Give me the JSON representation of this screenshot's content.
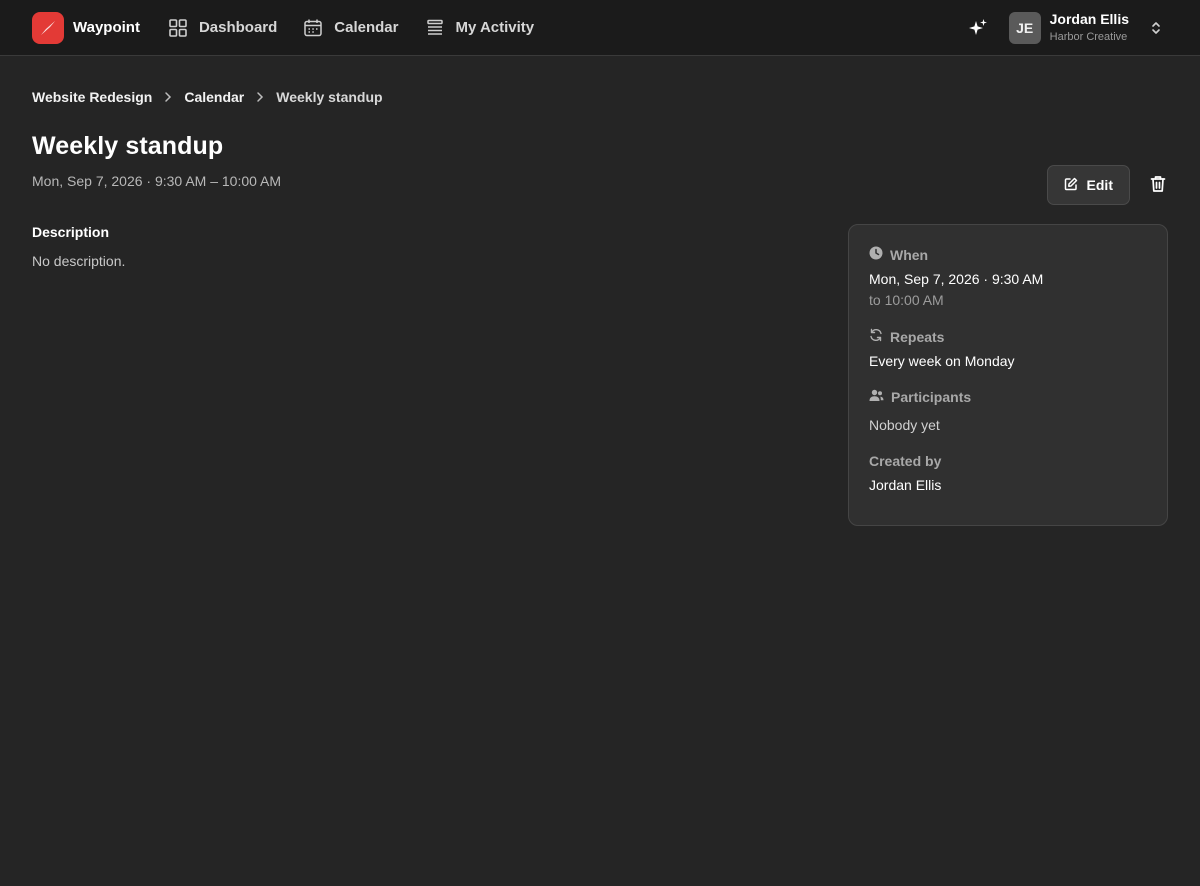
{
  "app": {
    "name": "Waypoint"
  },
  "nav": {
    "items": [
      {
        "label": "Dashboard",
        "icon": "grid-icon"
      },
      {
        "label": "Calendar",
        "icon": "calendar-icon"
      },
      {
        "label": "My Activity",
        "icon": "list-icon"
      }
    ]
  },
  "user": {
    "initials": "JE",
    "name": "Jordan Ellis",
    "org": "Harbor Creative"
  },
  "breadcrumb": {
    "items": [
      "Website Redesign",
      "Calendar",
      "Weekly standup"
    ]
  },
  "event": {
    "title": "Weekly standup",
    "subtitle": "Mon, Sep 7, 2026 · 9:30 AM – 10:00 AM"
  },
  "actions": {
    "edit_label": "Edit"
  },
  "description": {
    "heading": "Description",
    "text": "No description."
  },
  "details": {
    "when_label": "When",
    "when_value": "Mon, Sep 7, 2026 · 9:30 AM",
    "when_sub": "to 10:00 AM",
    "repeats_label": "Repeats",
    "repeats_value": "Every week on Monday",
    "participants_label": "Participants",
    "participants_value": "Nobody yet",
    "created_label": "Created by",
    "created_value": "Jordan Ellis"
  },
  "colors": {
    "background": "#252525",
    "topbar": "#1b1b1b",
    "brand": "#e33a36",
    "card": "#303030"
  }
}
